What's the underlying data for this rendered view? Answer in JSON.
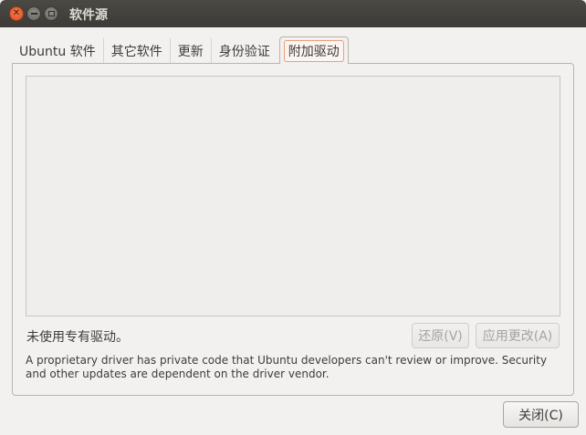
{
  "window": {
    "title": "软件源"
  },
  "tabs": [
    {
      "label": "Ubuntu 软件"
    },
    {
      "label": "其它软件"
    },
    {
      "label": "更新"
    },
    {
      "label": "身份验证"
    },
    {
      "label": "附加驱动"
    }
  ],
  "drivers": {
    "status": "未使用专有驱动。",
    "revert_label": "还原(V)",
    "apply_label": "应用更改(A)",
    "description": "A proprietary driver has private code that Ubuntu developers can't review or improve. Security and other updates are dependent on the driver vendor."
  },
  "footer": {
    "close_label": "关闭(C)"
  },
  "icons": {
    "close": "close-icon",
    "minimize": "minimize-icon",
    "maximize": "maximize-icon"
  }
}
